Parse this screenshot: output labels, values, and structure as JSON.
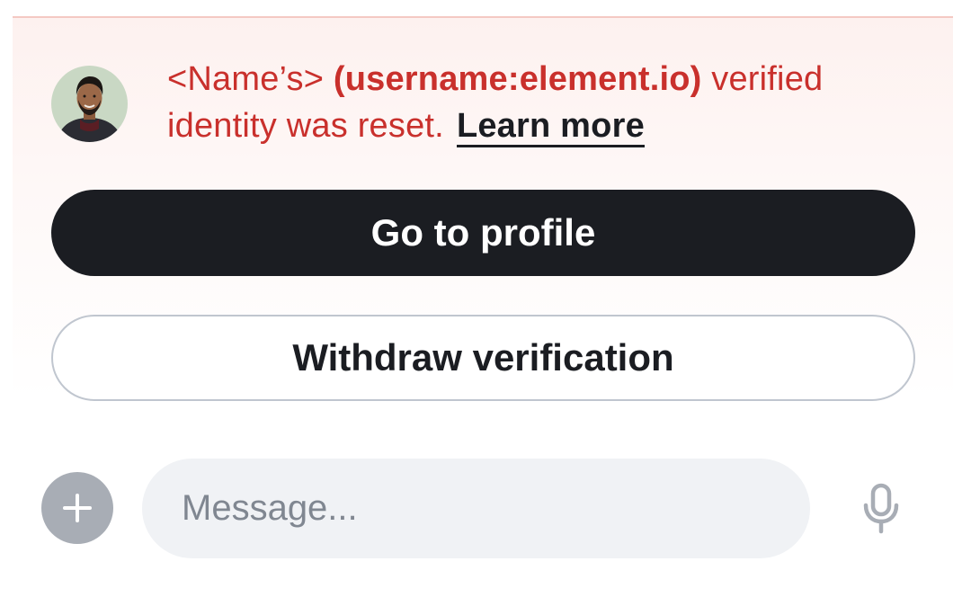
{
  "alert": {
    "name_placeholder": "<Name’s>",
    "user_id": "(username:element.io)",
    "text_after_user": " verified identity was reset.",
    "learn_more_label": "Learn more"
  },
  "actions": {
    "primary_label": "Go to profile",
    "secondary_label": "Withdraw verification"
  },
  "composer": {
    "placeholder": "Message...",
    "add_icon": "plus-icon",
    "mic_icon": "microphone-icon"
  },
  "colors": {
    "critical_text": "#c9302c",
    "primary_button": "#1b1d22",
    "banner_border": "#f4c9c3",
    "banner_background": "#fdf1ef",
    "composer_field": "#f0f2f5",
    "add_button": "#a8adb5"
  }
}
